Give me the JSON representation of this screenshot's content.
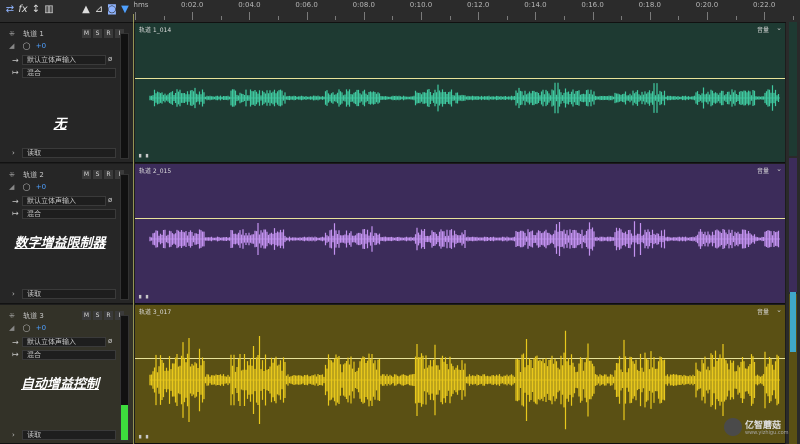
{
  "toolbar": {
    "icons": [
      "swap-icon",
      "fx-icon",
      "route-icon",
      "bars-icon",
      "mountain-icon",
      "lock-icon",
      "headphone-icon",
      "pin-icon"
    ],
    "fx_label": "fx"
  },
  "ruler": {
    "unit": "hms",
    "labels": [
      "0:02.0",
      "0:04.0",
      "0:06.0",
      "0:08.0",
      "0:10.0",
      "0:12.0",
      "0:14.0",
      "0:16.0",
      "0:18.0",
      "0:20.0",
      "0:22.0"
    ]
  },
  "tracks": [
    {
      "name": "轨道 1",
      "volume": "+0",
      "input": "默认立体声输入",
      "mix": "混合",
      "read": "读取",
      "annotation": "无",
      "clip_title": "轨道 1_014",
      "clip_vol": "音量",
      "bg": "#1e3a32",
      "wave": "#3fc9a0",
      "meter_level": 0
    },
    {
      "name": "轨道 2",
      "volume": "+0",
      "input": "默认立体声输入",
      "mix": "混合",
      "read": "读取",
      "annotation": "数字增益限制器",
      "clip_title": "轨道 2_015",
      "clip_vol": "音量",
      "bg": "#3c2c5a",
      "wave": "#c392f0",
      "meter_level": 0
    },
    {
      "name": "轨道 3",
      "volume": "+0",
      "input": "默认立体声输入",
      "mix": "混合",
      "read": "读取",
      "annotation": "自动增益控制",
      "clip_title": "轨道 3_017",
      "clip_vol": "音量",
      "bg": "#5a5014",
      "wave": "#e8c81c",
      "meter_level": 0.28
    }
  ],
  "button_labels": {
    "m": "M",
    "s": "S",
    "r": "R",
    "i": "I"
  },
  "watermark": {
    "text": "亿智蘑菇",
    "sub": "www.yizhigu.com"
  }
}
